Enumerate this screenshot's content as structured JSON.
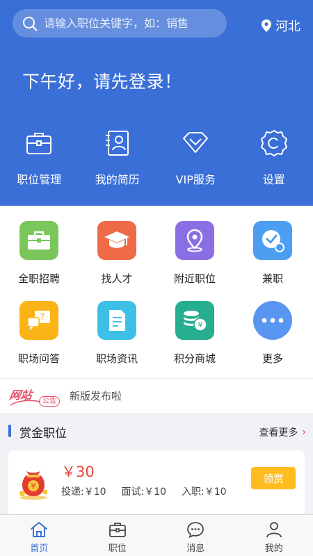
{
  "search": {
    "placeholder": "请输入职位关键字，如：销售"
  },
  "location": {
    "city": "河北"
  },
  "greeting": "下午好，请先登录！",
  "quick_actions": [
    {
      "label": "职位管理",
      "icon": "briefcase-icon"
    },
    {
      "label": "我的简历",
      "icon": "resume-icon"
    },
    {
      "label": "VIP服务",
      "icon": "diamond-icon"
    },
    {
      "label": "设置",
      "icon": "gear-icon"
    }
  ],
  "grid": [
    {
      "label": "全职招聘",
      "icon": "briefcase-icon",
      "color": "#7ac65a"
    },
    {
      "label": "找人才",
      "icon": "graduation-cap-icon",
      "color": "#ef6a47"
    },
    {
      "label": "附近职位",
      "icon": "map-pin-icon",
      "color": "#8a6fe4"
    },
    {
      "label": "兼职",
      "icon": "clock-icon",
      "color": "#4d9ef0"
    },
    {
      "label": "职场问答",
      "icon": "qa-chat-icon",
      "color": "#fbb415"
    },
    {
      "label": "职场资讯",
      "icon": "document-icon",
      "color": "#3ec0e6"
    },
    {
      "label": "积分商城",
      "icon": "coins-icon",
      "color": "#27ad8f"
    },
    {
      "label": "更多",
      "icon": "more-dots-icon",
      "color": "#5996f2"
    }
  ],
  "notice": {
    "logo_text": "网站",
    "logo_tag": "公告",
    "text": "新版发布啦"
  },
  "reward": {
    "title": "赏金职位",
    "more_label": "查看更多",
    "card": {
      "price": "￥30",
      "deliver": "投递:￥10",
      "interview": "面试:￥10",
      "onboard": "入职:￥10",
      "claim_label": "领赏"
    }
  },
  "tabs": [
    {
      "label": "首页",
      "icon": "home-icon",
      "active": true
    },
    {
      "label": "职位",
      "icon": "briefcase-icon",
      "active": false
    },
    {
      "label": "消息",
      "icon": "message-icon",
      "active": false
    },
    {
      "label": "我的",
      "icon": "user-icon",
      "active": false
    }
  ],
  "colors": {
    "primary": "#3a6fd7",
    "price": "#e9463c",
    "claim": "#ffbc1e",
    "notice": "#e94e68"
  }
}
